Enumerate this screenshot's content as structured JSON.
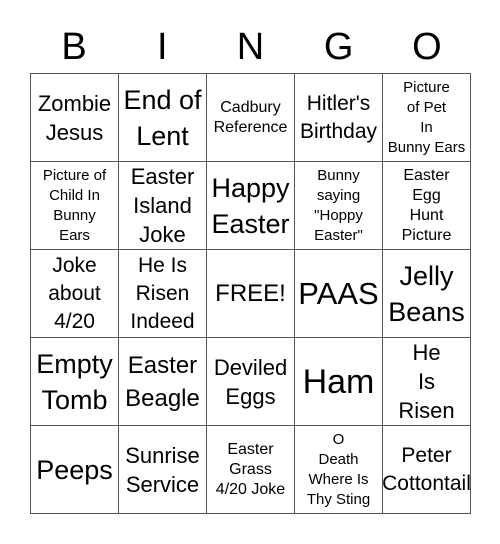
{
  "header": {
    "letters": [
      "B",
      "I",
      "N",
      "G",
      "O"
    ]
  },
  "cells": [
    [
      "Zombie Jesus",
      "End of Lent",
      "Cadbury Reference",
      "Hitler's Birthday",
      "Picture of Pet In Bunny Ears"
    ],
    [
      "Picture of Child In Bunny Ears",
      "Easter Island Joke",
      "Happy Easter",
      "Bunny saying \"Hoppy Easter\"",
      "Easter Egg Hunt Picture"
    ],
    [
      "Joke about 4/20",
      "He Is Risen Indeed",
      "FREE!",
      "PAAS",
      "Jelly Beans"
    ],
    [
      "Empty Tomb",
      "Easter Beagle",
      "Deviled Eggs",
      "Ham",
      "He Is Risen"
    ],
    [
      "Peeps",
      "Sunrise Service",
      "Easter Grass 4/20 Joke",
      "O Death Where Is Thy Sting",
      "Peter Cottontail"
    ]
  ],
  "cell_lines": [
    [
      [
        "Zombie",
        "Jesus"
      ],
      [
        "End of",
        "Lent"
      ],
      [
        "Cadbury",
        "Reference"
      ],
      [
        "Hitler's",
        "Birthday"
      ],
      [
        "Picture",
        "of Pet",
        "In",
        "Bunny Ears"
      ]
    ],
    [
      [
        "Picture of",
        "Child In",
        "Bunny",
        "Ears"
      ],
      [
        "Easter",
        "Island",
        "Joke"
      ],
      [
        "Happy",
        "Easter"
      ],
      [
        "Bunny",
        "saying",
        "\"Hoppy",
        "Easter\""
      ],
      [
        "Easter",
        "Egg",
        "Hunt",
        "Picture"
      ]
    ],
    [
      [
        "Joke",
        "about",
        "4/20"
      ],
      [
        "He Is",
        "Risen",
        "Indeed"
      ],
      [
        "FREE!"
      ],
      [
        "PAAS"
      ],
      [
        "Jelly",
        "Beans"
      ]
    ],
    [
      [
        "Empty",
        "Tomb"
      ],
      [
        "Easter",
        "Beagle"
      ],
      [
        "Deviled",
        "Eggs"
      ],
      [
        "Ham"
      ],
      [
        "He",
        "Is",
        "Risen"
      ]
    ],
    [
      [
        "Peeps"
      ],
      [
        "Sunrise",
        "Service"
      ],
      [
        "Easter",
        "Grass",
        "4/20 Joke"
      ],
      [
        "O",
        "Death",
        "Where Is",
        "Thy Sting"
      ],
      [
        "Peter",
        "Cottontail"
      ]
    ]
  ]
}
